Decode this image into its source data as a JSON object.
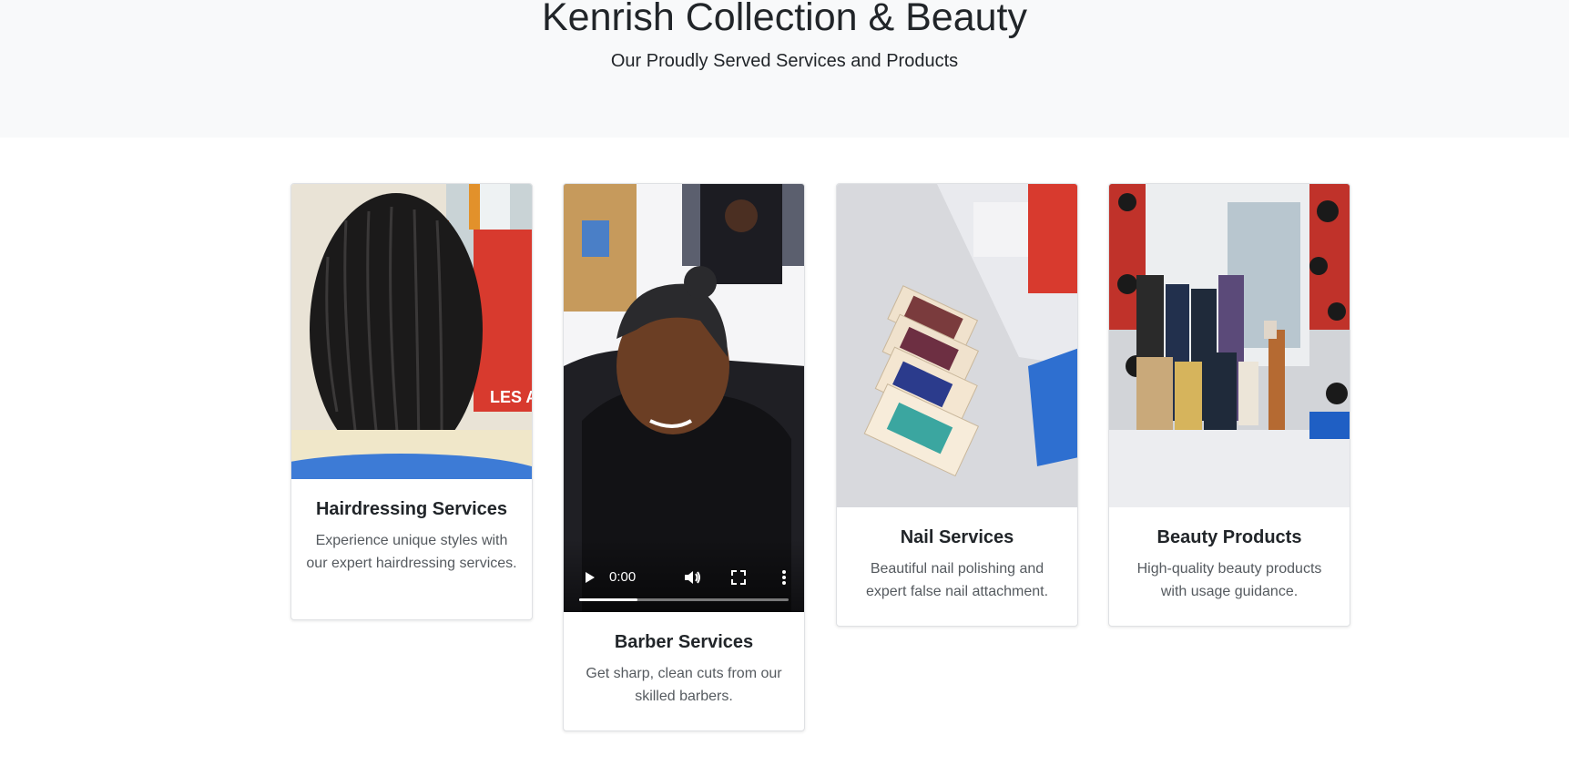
{
  "hero": {
    "title": "Kenrish Collection & Beauty",
    "subtitle": "Our Proudly Served Services and Products"
  },
  "cards": [
    {
      "title": "Hairdressing Services",
      "text": "Experience unique styles with our expert hairdressing services.",
      "media": "image"
    },
    {
      "title": "Barber Services",
      "text": "Get sharp, clean cuts from our skilled barbers.",
      "media": "video",
      "video": {
        "time": "0:00",
        "progress": 0.28
      }
    },
    {
      "title": "Nail Services",
      "text": "Beautiful nail polishing and expert false nail attachment.",
      "media": "image"
    },
    {
      "title": "Beauty Products",
      "text": "High-quality beauty products with usage guidance.",
      "media": "image"
    }
  ],
  "icons": {
    "play": "play-icon",
    "volume": "volume-icon",
    "fullscreen": "fullscreen-icon",
    "more": "more-options-icon"
  }
}
